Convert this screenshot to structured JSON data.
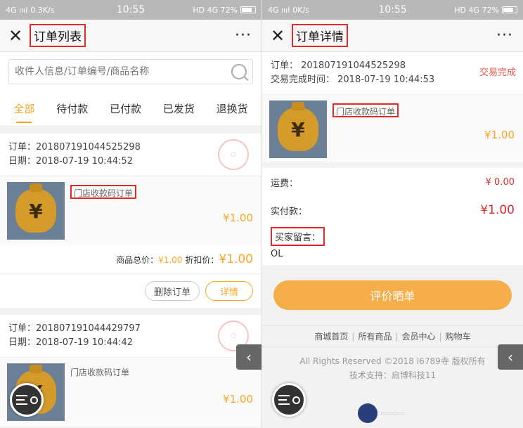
{
  "status_left": {
    "signal": "4G ıııl",
    "speed": "0.3K/s",
    "time": "10:55",
    "right": "HD 4G 72%"
  },
  "status_right": {
    "signal": "4G ıııl",
    "speed": "0K/s",
    "time": "10:55",
    "right": "HD 4G 72%"
  },
  "list_page": {
    "title": "订单列表",
    "search_placeholder": "收件人信息/订单编号/商品名称",
    "tabs": [
      "全部",
      "待付款",
      "已付款",
      "已发货",
      "退换货"
    ],
    "orders": [
      {
        "order_no": "订单：201807191044525298",
        "date": "日期：2018-07-19 10:44:52",
        "product_name": "门店收款码订单",
        "price": "¥1.00",
        "total_label": "商品总价：",
        "total_value": "¥1.00",
        "discount_label": "折扣价：",
        "discount_value": "¥1.00",
        "delete_label": "删除订单",
        "detail_label": "详情"
      },
      {
        "order_no": "订单：201807191044429797",
        "date": "日期：2018-07-19 10:44:42",
        "product_name": "门店收款码订单",
        "price": "¥1.00"
      }
    ]
  },
  "detail_page": {
    "title": "订单详情",
    "order_no": "订单：  201807191044525298",
    "done_time": "交易完成时间：  2018-07-19 10:44:53",
    "status": "交易完成",
    "product_name": "门店收款码订单",
    "price": "¥1.00",
    "shipping_label": "运费：",
    "shipping_value": "¥ 0.00",
    "paid_label": "实付款：",
    "paid_value": "¥1.00",
    "remark_label": "买家留言：",
    "remark_value": "OL",
    "eval_button": "评价晒单",
    "footer_links": [
      "商城首页",
      "所有商品",
      "会员中心",
      "购物车"
    ],
    "copyright": "All Rights Reserved ©2018 I6789寺 版权所有",
    "tech_support": "技术支持：启博科技11"
  }
}
